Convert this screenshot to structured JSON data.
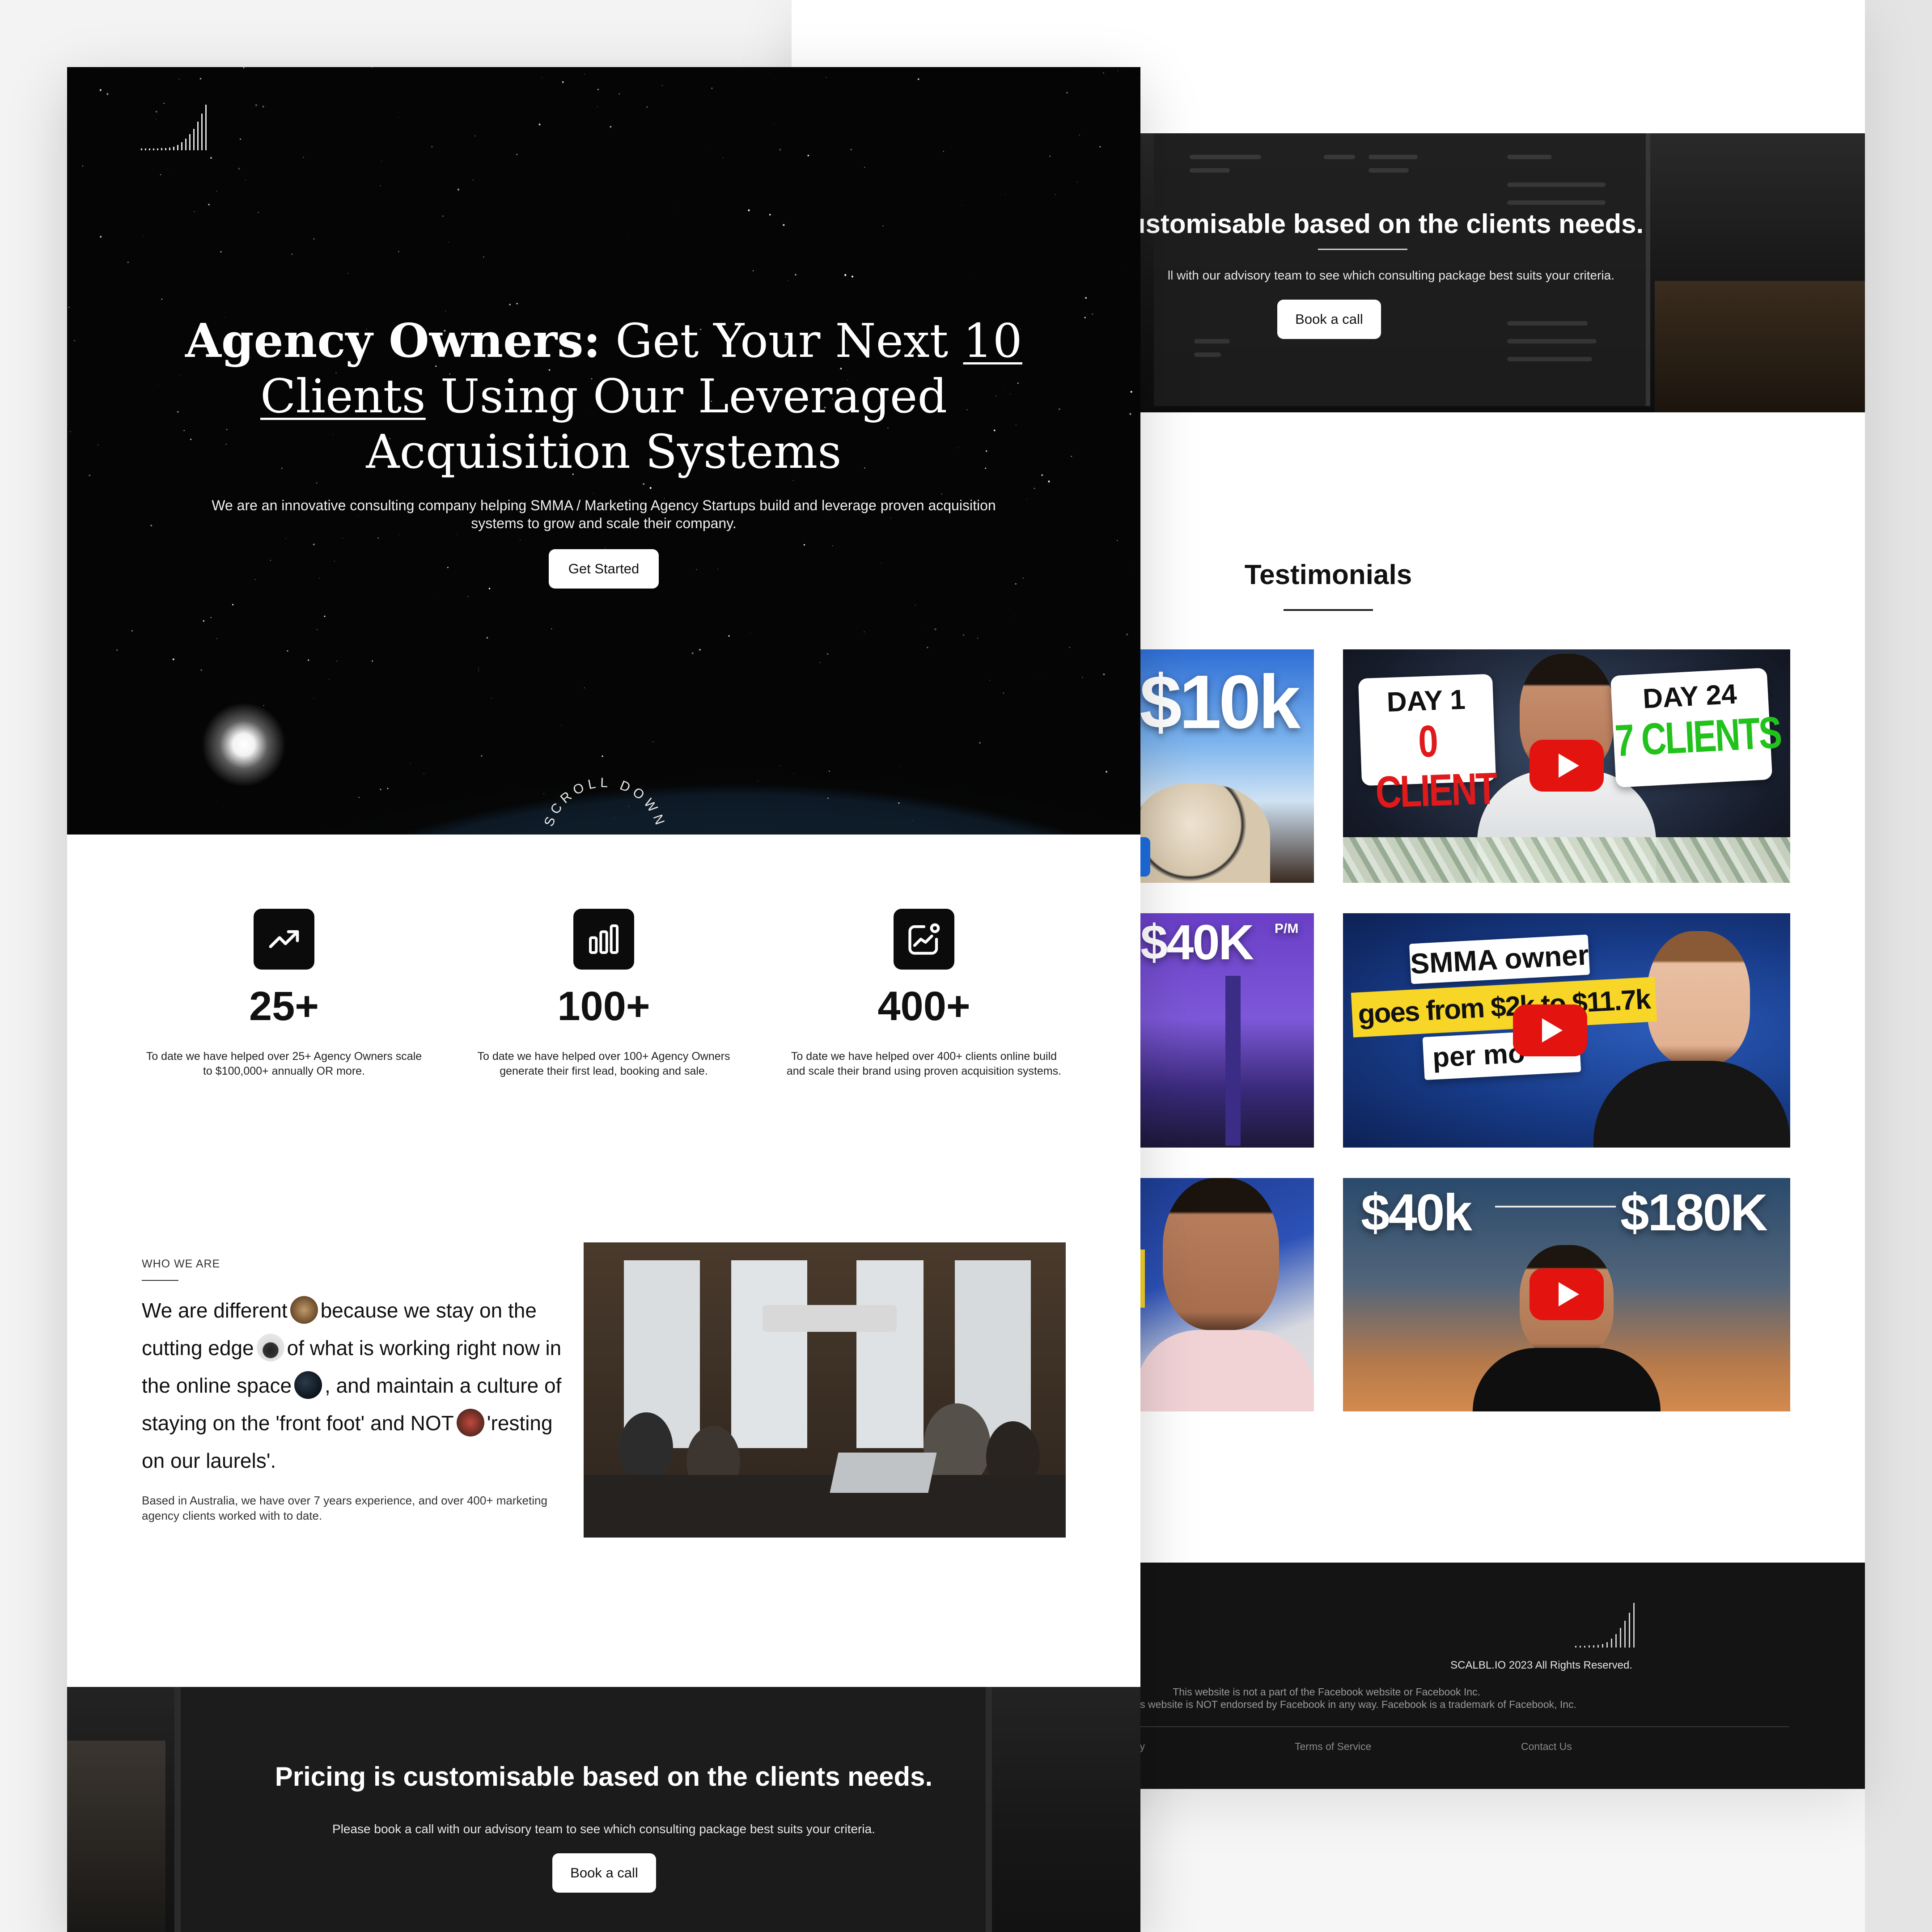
{
  "hero": {
    "title_bold": "Agency Owners:",
    "title_part1": " Get Your Next ",
    "title_underlined": "10 Clients",
    "title_part2": " Using Our Leveraged Acquisition Systems",
    "subtitle": "We are an innovative consulting company helping SMMA / Marketing Agency Startups build and leverage proven acquisition systems to grow and scale their company.",
    "cta_label": "Get Started",
    "scroll_text": "SCROLL DOWN SCROLL DOWN "
  },
  "stats": [
    {
      "icon": "trending-up-icon",
      "value": "25+",
      "description": "To date we have helped over 25+ Agency Owners scale to $100,000+ annually OR more."
    },
    {
      "icon": "bar-chart-icon",
      "value": "100+",
      "description": "To date we have helped over 100+ Agency Owners generate their first lead, booking and sale."
    },
    {
      "icon": "growth-chart-icon",
      "value": "400+",
      "description": "To date we have helped over 400+ clients online build and scale their brand using proven acquisition systems."
    }
  ],
  "who": {
    "label": "WHO WE ARE",
    "text_1": "We are different",
    "text_2": "because we stay on the cutting edge",
    "text_3": "of what is working right now in the online space",
    "text_4": ", and maintain a culture of staying on the 'front foot' and NOT",
    "text_5": "'resting on our laurels'.",
    "small": "Based in Australia, we have over 7 years experience, and over 400+ marketing agency clients worked with to date."
  },
  "pricing": {
    "title": "Pricing is customisable based on the clients needs.",
    "title_cropped": "ustomisable based on the clients needs.",
    "subtitle": "Please book a call with our advisory team to see which consulting package best suits your criteria.",
    "subtitle_cropped": "ll with our advisory team to see which consulting package best suits your criteria.",
    "cta_label": "Book a call"
  },
  "testimonials": {
    "title": "Testimonials",
    "videos": [
      {
        "headline": "$10k"
      },
      {
        "left_sign_top": "DAY 1",
        "left_sign_bottom": "0 CLIENT",
        "right_sign_top": "DAY 24",
        "right_sign_bottom": "7 CLIENTS"
      },
      {
        "headline": "$40K",
        "suffix": "P/M"
      },
      {
        "line1": "SMMA owner",
        "line2": "goes from $2k to $11.7k",
        "line3": "per mo"
      },
      {
        "headline": ""
      },
      {
        "from": "$40k",
        "to": "$180K"
      }
    ]
  },
  "footer": {
    "copyright": "SCALBL.IO 2023 All Rights Reserved.",
    "disclaimer_1": "This website is not a part of the Facebook website or Facebook Inc.",
    "disclaimer_2": "his website is NOT endorsed by Facebook in any way. Facebook is a trademark of Facebook, Inc.",
    "link_1": "y",
    "link_2": "Terms of Service",
    "link_3": "Contact Us"
  },
  "colors": {
    "dark": "#0b0b0b",
    "youtube_red": "#e3140f",
    "green_text": "#22c21c",
    "red_text": "#e0191b"
  }
}
